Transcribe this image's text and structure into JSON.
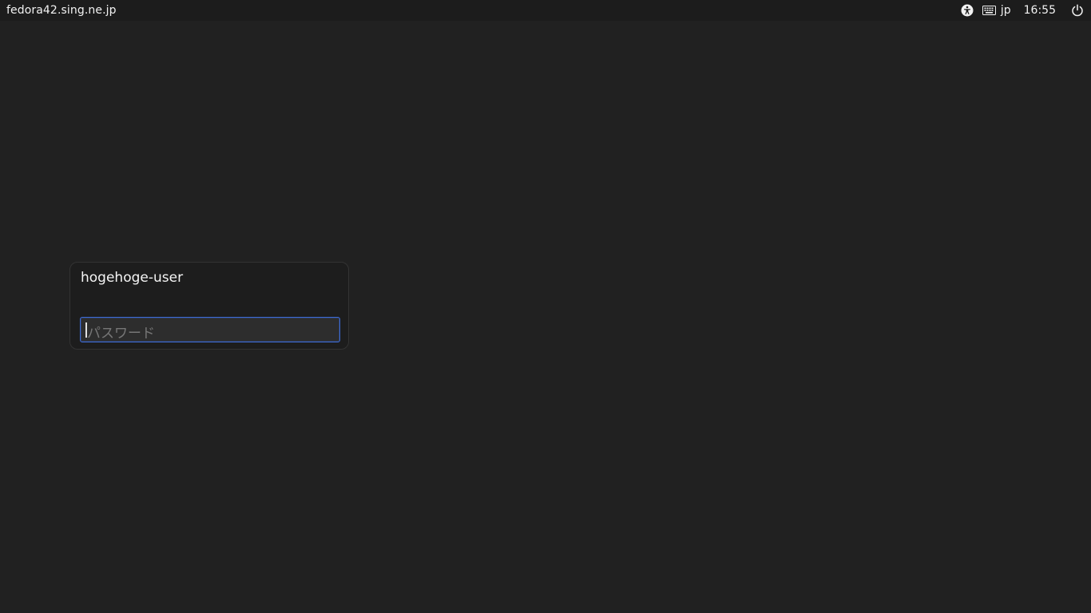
{
  "topbar": {
    "hostname": "fedora42.sing.ne.jp",
    "keyboard_layout": "jp",
    "clock": "16:55",
    "icons": {
      "accessibility": "accessibility-icon",
      "keyboard": "keyboard-icon",
      "power": "power-icon"
    }
  },
  "login": {
    "username": "hogehoge-user",
    "password_placeholder": "パスワード",
    "password_value": ""
  },
  "colors": {
    "background": "#212121",
    "topbar": "#1c1c1c",
    "card": "#1d1d1d",
    "focus_border": "#3d6bd6"
  }
}
